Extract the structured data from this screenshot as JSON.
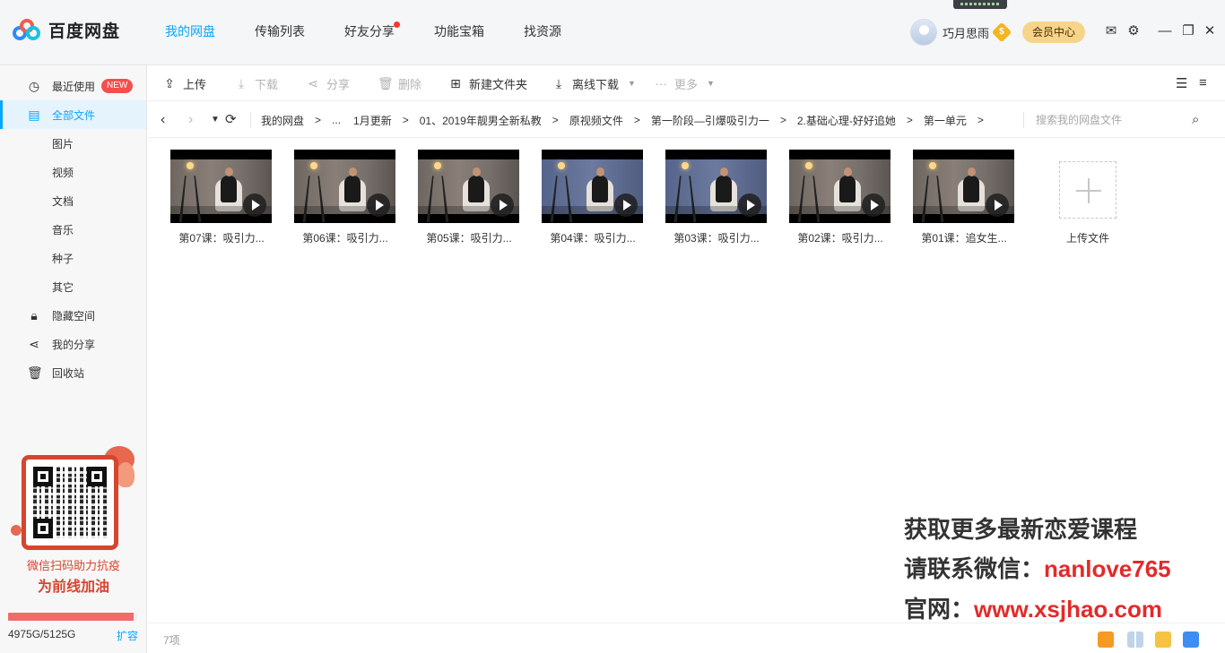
{
  "app": {
    "name": "百度网盘",
    "nav_tabs": [
      {
        "label": "我的网盘"
      },
      {
        "label": "传输列表"
      },
      {
        "label": "好友分享"
      },
      {
        "label": "功能宝箱"
      },
      {
        "label": "找资源"
      }
    ],
    "active_tab": "我的网盘",
    "user": {
      "name": "巧月思雨",
      "vip_badge": "$"
    },
    "member_center": "会员中心"
  },
  "sidebar": {
    "items": [
      {
        "label": "最近使用",
        "icon": "clock-icon",
        "badge": "NEW"
      },
      {
        "label": "全部文件",
        "icon": "document-icon"
      },
      {
        "label": "图片"
      },
      {
        "label": "视频"
      },
      {
        "label": "文档"
      },
      {
        "label": "音乐"
      },
      {
        "label": "种子"
      },
      {
        "label": "其它"
      },
      {
        "label": "隐藏空间",
        "icon": "lock-icon"
      },
      {
        "label": "我的分享",
        "icon": "share-icon"
      },
      {
        "label": "回收站",
        "icon": "trash-icon"
      }
    ],
    "promo": {
      "line1": "微信扫码助力抗疫",
      "line2": "为前线加油"
    },
    "quota": {
      "text": "4975G/5125G",
      "used_fraction": 0.971,
      "expand": "扩容"
    }
  },
  "toolbar": {
    "upload": "上传",
    "download": "下载",
    "share": "分享",
    "delete": "删除",
    "new_folder": "新建文件夹",
    "offline_download": "离线下载",
    "more": "更多"
  },
  "breadcrumb": {
    "items": [
      "我的网盘",
      "...",
      "1月更新",
      "01、2019年靓男全新私教",
      "原视频文件",
      "第一阶段—引爆吸引力一",
      "2.基础心理-好好追她",
      "第一单元"
    ],
    "search_placeholder": "搜索我的网盘文件"
  },
  "files": [
    {
      "name": "第07课：吸引力...",
      "scene": "warm"
    },
    {
      "name": "第06课：吸引力...",
      "scene": "warm"
    },
    {
      "name": "第05课：吸引力...",
      "scene": "warm"
    },
    {
      "name": "第04课：吸引力...",
      "scene": "cool"
    },
    {
      "name": "第03课：吸引力...",
      "scene": "cool"
    },
    {
      "name": "第02课：吸引力...",
      "scene": "warm"
    },
    {
      "name": "第01课：追女生...",
      "scene": "warm"
    }
  ],
  "upload_tile_label": "上传文件",
  "status": {
    "count": "7项"
  },
  "watermark": {
    "line1": "获取更多最新恋爱课程",
    "line2_prefix": "请联系微信：",
    "line2_value": "nanlove765",
    "line3_prefix": "官网：",
    "line3_value": "www.xsjhao.com"
  },
  "colors": {
    "accent": "#06a7ff",
    "badge_red": "#f54e4e",
    "quota_fill": "#f26b6b",
    "watermark_red": "#e32a2a"
  }
}
